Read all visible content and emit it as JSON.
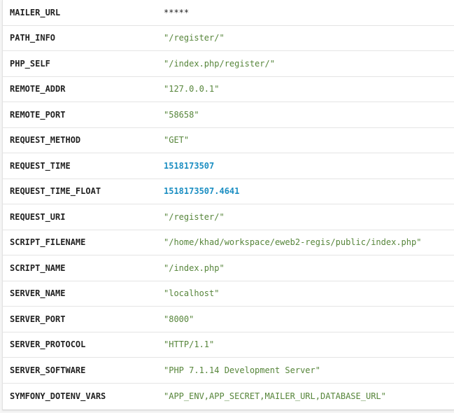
{
  "server_vars": {
    "rows": [
      {
        "key": "MAILER_URL",
        "value": "*****",
        "kind": "plain"
      },
      {
        "key": "PATH_INFO",
        "value": "\"/register/\"",
        "kind": "str"
      },
      {
        "key": "PHP_SELF",
        "value": "\"/index.php/register/\"",
        "kind": "str"
      },
      {
        "key": "REMOTE_ADDR",
        "value": "\"127.0.0.1\"",
        "kind": "str"
      },
      {
        "key": "REMOTE_PORT",
        "value": "\"58658\"",
        "kind": "str"
      },
      {
        "key": "REQUEST_METHOD",
        "value": "\"GET\"",
        "kind": "str"
      },
      {
        "key": "REQUEST_TIME",
        "value": "1518173507",
        "kind": "num"
      },
      {
        "key": "REQUEST_TIME_FLOAT",
        "value": "1518173507.4641",
        "kind": "num"
      },
      {
        "key": "REQUEST_URI",
        "value": "\"/register/\"",
        "kind": "str"
      },
      {
        "key": "SCRIPT_FILENAME",
        "value": "\"/home/khad/workspace/eweb2-regis/public/index.php\"",
        "kind": "str"
      },
      {
        "key": "SCRIPT_NAME",
        "value": "\"/index.php\"",
        "kind": "str"
      },
      {
        "key": "SERVER_NAME",
        "value": "\"localhost\"",
        "kind": "str"
      },
      {
        "key": "SERVER_PORT",
        "value": "\"8000\"",
        "kind": "str"
      },
      {
        "key": "SERVER_PROTOCOL",
        "value": "\"HTTP/1.1\"",
        "kind": "str"
      },
      {
        "key": "SERVER_SOFTWARE",
        "value": "\"PHP 7.1.14 Development Server\"",
        "kind": "str"
      },
      {
        "key": "SYMFONY_DOTENV_VARS",
        "value": "\"APP_ENV,APP_SECRET,MAILER_URL,DATABASE_URL\"",
        "kind": "str"
      }
    ]
  },
  "colors": {
    "string_value": "#56853a",
    "number_value": "#1b8ec2",
    "key_text": "#222222",
    "row_border": "#e4e4e4"
  }
}
